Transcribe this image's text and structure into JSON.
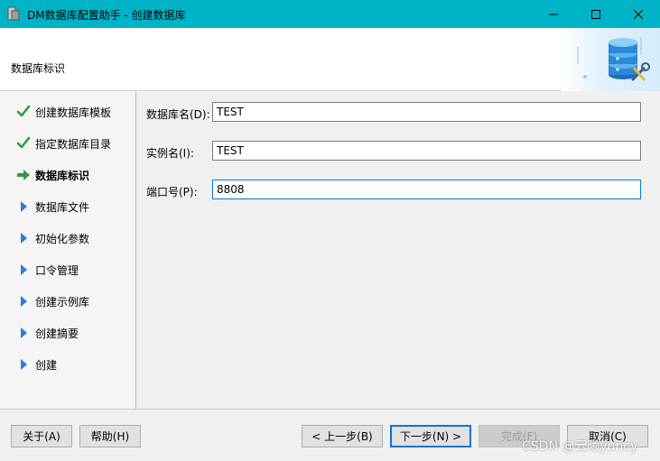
{
  "window": {
    "title": "DM数据库配置助手 - 创建数据库",
    "controls": {
      "minimize": "minimize-icon",
      "maximize": "maximize-icon",
      "close": "close-icon"
    }
  },
  "header": {
    "step_title": "数据库标识",
    "art_icon": "database-settings-icon"
  },
  "sidebar": {
    "items": [
      {
        "label": "创建数据库模板",
        "state": "done",
        "icon": "checkmark-icon"
      },
      {
        "label": "指定数据库目录",
        "state": "done",
        "icon": "checkmark-icon"
      },
      {
        "label": "数据库标识",
        "state": "current",
        "icon": "arrow-right-icon"
      },
      {
        "label": "数据库文件",
        "state": "pending",
        "icon": "triangle-right-icon"
      },
      {
        "label": "初始化参数",
        "state": "pending",
        "icon": "triangle-right-icon"
      },
      {
        "label": "口令管理",
        "state": "pending",
        "icon": "triangle-right-icon"
      },
      {
        "label": "创建示例库",
        "state": "pending",
        "icon": "triangle-right-icon"
      },
      {
        "label": "创建摘要",
        "state": "pending",
        "icon": "triangle-right-icon"
      },
      {
        "label": "创建",
        "state": "pending",
        "icon": "triangle-right-icon"
      }
    ]
  },
  "form": {
    "db_name": {
      "label": "数据库名(D):",
      "value": "TEST"
    },
    "instance_name": {
      "label": "实例名(I):",
      "value": "TEST"
    },
    "port": {
      "label": "端口号(P):",
      "value": "8808"
    }
  },
  "buttons": {
    "about": "关于(A)",
    "help": "帮助(H)",
    "prev": "< 上一步(B)",
    "next": "下一步(N) >",
    "finish": "完成(F)",
    "cancel": "取消(C)"
  },
  "watermark": "CSDN @云曦yuncy",
  "colors": {
    "titlebar": "#00b4c8",
    "accent": "#0078d7",
    "check": "#2e9e3e",
    "arrow": "#2a7fd4"
  }
}
